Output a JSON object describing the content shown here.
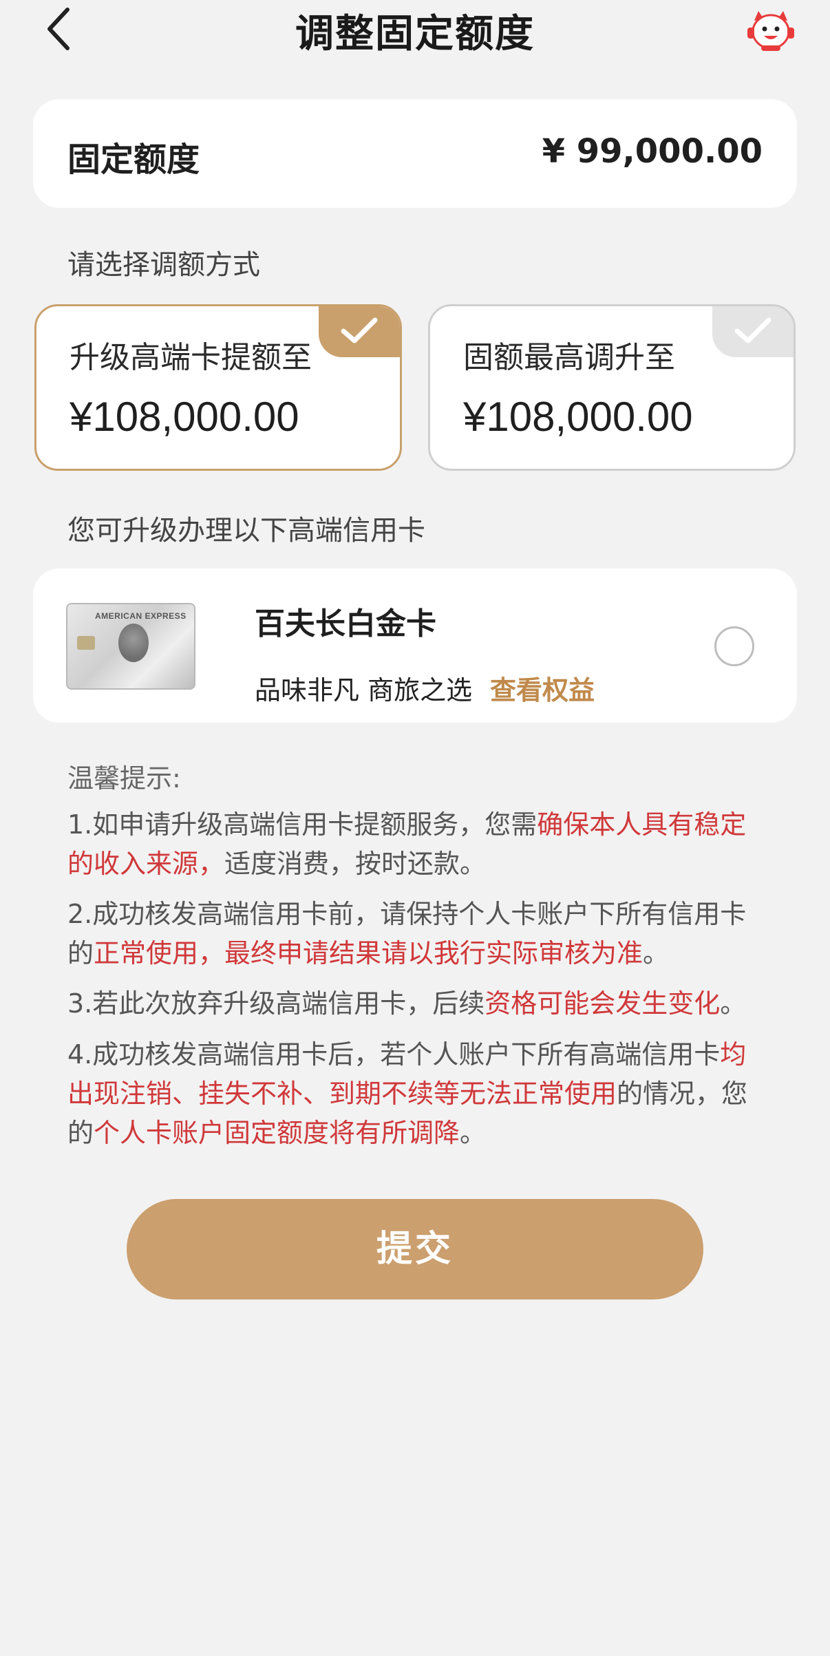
{
  "header": {
    "title": "调整固定额度"
  },
  "fixed_limit": {
    "label": "固定额度",
    "value": "¥ 99,000.00"
  },
  "method_section": {
    "label": "请选择调额方式"
  },
  "options": [
    {
      "title": "升级高端卡提额至",
      "value": "¥108,000.00",
      "selected": true
    },
    {
      "title": "固额最高调升至",
      "value": "¥108,000.00",
      "selected": false
    }
  ],
  "cards_section": {
    "label": "您可升级办理以下高端信用卡"
  },
  "card": {
    "name": "百夫长白金卡",
    "description": "品味非凡 商旅之选",
    "link": "查看权益",
    "image_brand": "AMERICAN EXPRESS"
  },
  "tips": {
    "title": "温馨提示:",
    "items": [
      {
        "p1": "1.如申请升级高端信用卡提额服务，您需",
        "h1": "确保本人具有稳定的收入来源，",
        "p2": "适度消费，按时还款。"
      },
      {
        "p1": "2.成功核发高端信用卡前，请保持个人卡账户下所有信用卡的",
        "h1": "正常使用，最终申请结果请以我行实际审核为准",
        "p2": "。"
      },
      {
        "p1": "3.若此次放弃升级高端信用卡，后续",
        "h1": "资格可能会发生变化",
        "p2": "。"
      },
      {
        "p1": "4.成功核发高端信用卡后，若个人账户下所有高端信用卡",
        "h1": "均出现注销、挂失不补、到期不续等无法正常使用",
        "p2": "的情况，您的",
        "h2": "个人卡账户固定额度将有所调降",
        "p3": "。"
      }
    ]
  },
  "submit": {
    "label": "提交"
  },
  "colors": {
    "accent": "#c9a06c",
    "highlight": "#d0383a",
    "background": "#f2f2f2"
  }
}
